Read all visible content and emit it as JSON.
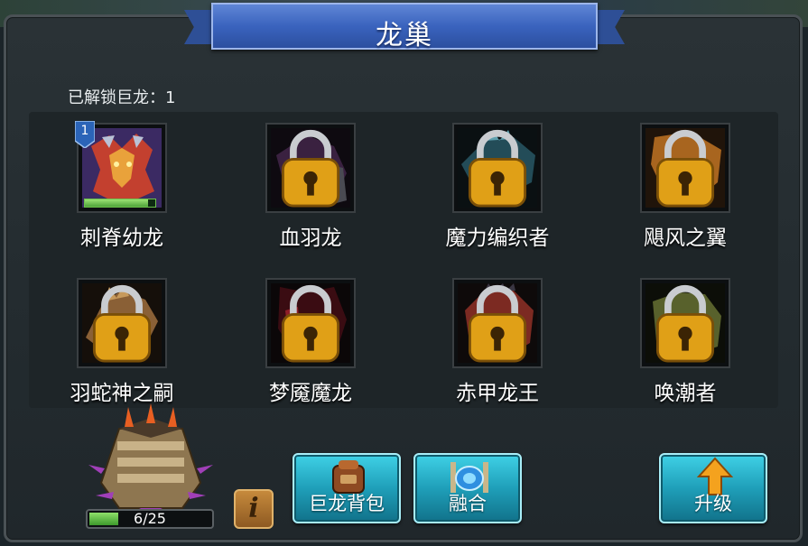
{
  "header": {
    "title": "龙巢"
  },
  "unlocked": {
    "label": "已解锁巨龙：1"
  },
  "dragons": [
    {
      "name": "刺脊幼龙",
      "locked": false,
      "level": "1",
      "xp_fraction": 0.9,
      "color": "#c3402f"
    },
    {
      "name": "血羽龙",
      "locked": true,
      "color": "#5a2a55"
    },
    {
      "name": "魔力编织者",
      "locked": true,
      "color": "#2e6c7c"
    },
    {
      "name": "飓风之翼",
      "locked": true,
      "color": "#c47e2a"
    },
    {
      "name": "羽蛇神之嗣",
      "locked": true,
      "color": "#9b7040"
    },
    {
      "name": "梦魇魔龙",
      "locked": true,
      "color": "#6a1820"
    },
    {
      "name": "赤甲龙王",
      "locked": true,
      "color": "#b8402a"
    },
    {
      "name": "唤潮者",
      "locked": true,
      "color": "#6f7a3a"
    }
  ],
  "nest": {
    "capacity_text": "6/25",
    "capacity_fraction": 0.24
  },
  "buttons": {
    "info": "i",
    "bag": "巨龙背包",
    "fuse": "融合",
    "upgrade": "升级"
  },
  "icons": [
    "lock-icon",
    "info-icon",
    "backpack-icon",
    "portal-icon",
    "arrow-up-icon",
    "tower-icon",
    "level-badge-icon"
  ]
}
